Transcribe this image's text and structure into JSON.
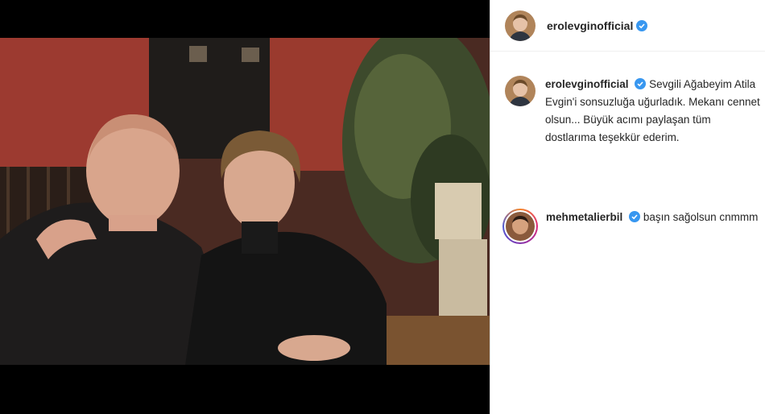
{
  "post": {
    "author": "erolevginofficial",
    "verified_color": "#3897f0"
  },
  "caption": {
    "author": "erolevginofficial",
    "text": "Sevgili Ağabeyim Atila Evgin'i sonsuzluğa uğurladık. Mekanı cennet olsun... Büyük acımı paylaşan tüm dostlarıma teşekkür ederim."
  },
  "comment": {
    "author": "mehmetalierbil",
    "text": "başın sağolsun cnmmm"
  }
}
